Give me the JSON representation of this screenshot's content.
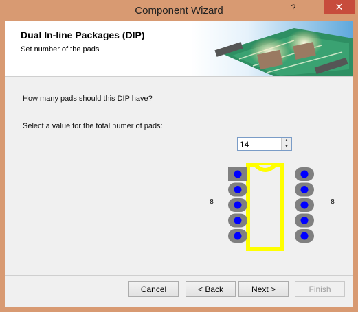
{
  "window": {
    "title": "Component Wizard",
    "help_glyph": "?",
    "close_glyph": "✕"
  },
  "header": {
    "title": "Dual In-line Packages (DIP)",
    "subtitle": "Set number of the pads"
  },
  "main": {
    "question": "How many pads should this DIP have?",
    "select_label": "Select a value for the total numer of pads:",
    "pad_count": "14"
  },
  "preview": {
    "left_designator": "8",
    "right_designator": "8",
    "outline_color": "#ffff00",
    "pad_color": "#808080",
    "hole_color": "#0000ff"
  },
  "buttons": {
    "cancel": "Cancel",
    "back": "< Back",
    "next": "Next >",
    "finish": "Finish"
  }
}
